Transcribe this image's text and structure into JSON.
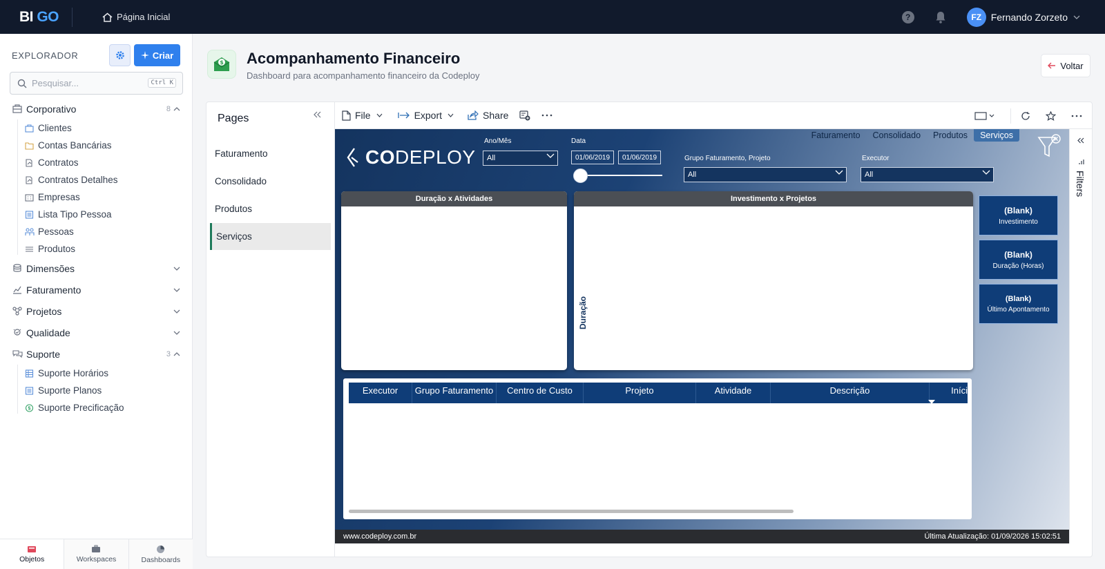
{
  "topbar": {
    "logo_bi": "BI",
    "logo_go": "GO",
    "home_label": "Página Inicial",
    "help_label": "?",
    "user": {
      "initials": "FZ",
      "name": "Fernando Zorzeto"
    }
  },
  "sidebar": {
    "title": "EXPLORADOR",
    "create_label": "Criar",
    "search": {
      "placeholder": "Pesquisar...",
      "shortcut": "Ctrl K"
    },
    "groups": [
      {
        "label": "Corporativo",
        "count": "8",
        "expanded": true,
        "children": [
          "Clientes",
          "Contas Bancárias",
          "Contratos",
          "Contratos Detalhes",
          "Empresas",
          "Lista Tipo Pessoa",
          "Pessoas",
          "Produtos"
        ]
      },
      {
        "label": "Dimensões",
        "expanded": false
      },
      {
        "label": "Faturamento",
        "expanded": false
      },
      {
        "label": "Projetos",
        "expanded": false
      },
      {
        "label": "Qualidade",
        "expanded": false
      },
      {
        "label": "Suporte",
        "count": "3",
        "expanded": true,
        "children": [
          "Suporte Horários",
          "Suporte Planos",
          "Suporte Precificação"
        ]
      }
    ],
    "bottom_tabs": [
      "Objetos",
      "Workspaces",
      "Dashboards"
    ],
    "active_bottom_tab": "Objetos"
  },
  "header": {
    "title": "Acompanhamento Financeiro",
    "subtitle": "Dashboard para acompanhamento financeiro da Codeploy",
    "back_label": "Voltar"
  },
  "pages_panel": {
    "title": "Pages",
    "items": [
      "Faturamento",
      "Consolidado",
      "Produtos",
      "Serviços"
    ],
    "active": "Serviços"
  },
  "toolbar": {
    "file_label": "File",
    "export_label": "Export",
    "share_label": "Share"
  },
  "report": {
    "logo_co": "CO",
    "logo_rest": "DEPLOY",
    "nav_tabs": [
      "Faturamento",
      "Consolidado",
      "Produtos",
      "Serviços"
    ],
    "active_nav_tab": "Serviços",
    "slicers": {
      "ano_mes_label": "Ano/Mês",
      "ano_mes_value": "All",
      "data_label": "Data",
      "date_from": "01/06/2019",
      "date_to": "01/06/2019",
      "grupo_label": "Grupo Faturamento, Projeto",
      "grupo_value": "All",
      "executor_label": "Executor",
      "executor_value": "All"
    },
    "chart1_title": "Duração x Atividades",
    "chart2_title": "Investimento x Projetos",
    "chart2_ylabel": "Duração",
    "kpis": [
      {
        "value": "(Blank)",
        "label": "Investimento"
      },
      {
        "value": "(Blank)",
        "label": "Duração (Horas)"
      },
      {
        "value": "(Blank)",
        "label": "Último Apontamento"
      }
    ],
    "table_columns": [
      "Executor",
      "Grupo Faturamento",
      "Centro de Custo",
      "Projeto",
      "Atividade",
      "Descrição",
      "Iníci"
    ],
    "footer_left": "www.codeploy.com.br",
    "footer_right": "Última Atualização: 01/09/2026 15:02:51"
  },
  "filters_label": "Filters"
}
